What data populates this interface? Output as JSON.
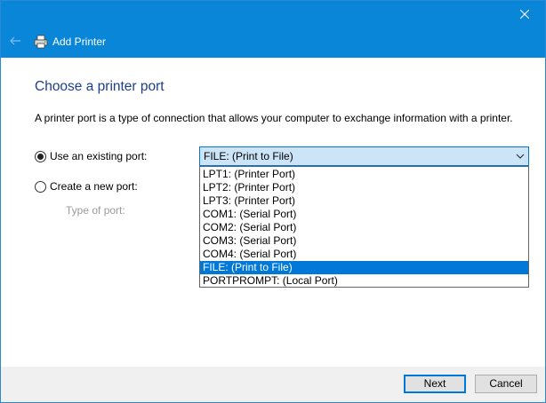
{
  "header": {
    "title": "Add Printer"
  },
  "page": {
    "title": "Choose a printer port",
    "description": "A printer port is a type of connection that allows your computer to exchange information with a printer."
  },
  "options": {
    "existing_label": "Use an existing port:",
    "new_label": "Create a new port:",
    "type_of_port_label": "Type of port:"
  },
  "port_select": {
    "selected": "FILE: (Print to File)",
    "items": [
      "LPT1: (Printer Port)",
      "LPT2: (Printer Port)",
      "LPT3: (Printer Port)",
      "COM1: (Serial Port)",
      "COM2: (Serial Port)",
      "COM3: (Serial Port)",
      "COM4: (Serial Port)",
      "FILE: (Print to File)",
      "PORTPROMPT: (Local Port)"
    ],
    "highlighted_index": 7
  },
  "footer": {
    "next_label": "Next",
    "cancel_label": "Cancel"
  },
  "colors": {
    "accent": "#0a86d8",
    "highlight": "#0078d7",
    "title_text": "#1e3e8c"
  }
}
